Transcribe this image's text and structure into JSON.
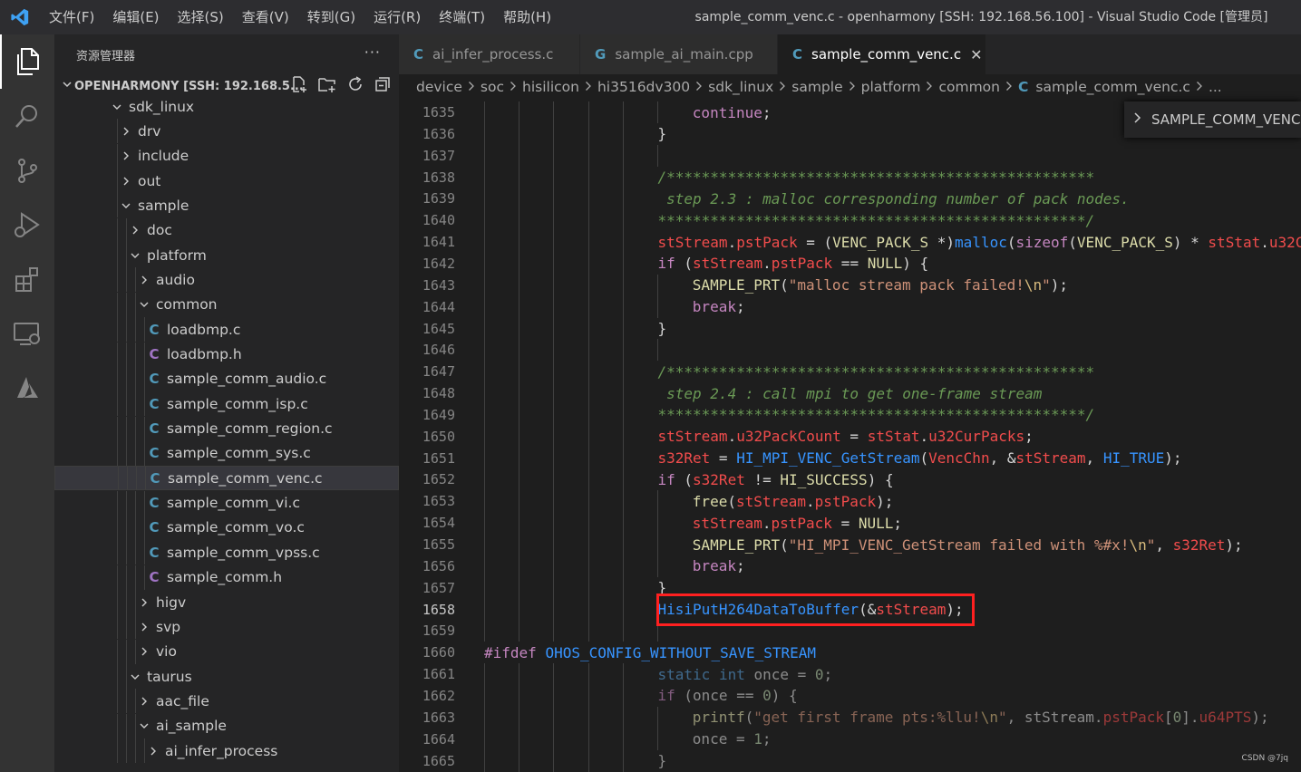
{
  "titlebar": {
    "menus": [
      "文件(F)",
      "编辑(E)",
      "选择(S)",
      "查看(V)",
      "转到(G)",
      "运行(R)",
      "终端(T)",
      "帮助(H)"
    ],
    "window_title": "sample_comm_venc.c - openharmony [SSH: 192.168.56.100] - Visual Studio Code [管理员]"
  },
  "activitybar": {
    "icons": [
      "explorer-icon",
      "search-icon",
      "source-control-icon",
      "run-debug-icon",
      "extensions-icon",
      "remote-explorer-icon",
      "azure-icon"
    ]
  },
  "sidebar": {
    "title": "资源管理器",
    "more": "···",
    "folder": "OPENHARMONY [SSH: 192.168.5...",
    "tree": [
      {
        "label": "sdk_linux",
        "type": "folder",
        "open": true,
        "depth": 0
      },
      {
        "label": "drv",
        "type": "folder",
        "open": false,
        "depth": 1
      },
      {
        "label": "include",
        "type": "folder",
        "open": false,
        "depth": 1
      },
      {
        "label": "out",
        "type": "folder",
        "open": false,
        "depth": 1
      },
      {
        "label": "sample",
        "type": "folder",
        "open": true,
        "depth": 1
      },
      {
        "label": "doc",
        "type": "folder",
        "open": false,
        "depth": 2
      },
      {
        "label": "platform",
        "type": "folder",
        "open": true,
        "depth": 2
      },
      {
        "label": "audio",
        "type": "folder",
        "open": false,
        "depth": 3
      },
      {
        "label": "common",
        "type": "folder",
        "open": true,
        "depth": 3
      },
      {
        "label": "loadbmp.c",
        "type": "c",
        "depth": 4
      },
      {
        "label": "loadbmp.h",
        "type": "h",
        "depth": 4
      },
      {
        "label": "sample_comm_audio.c",
        "type": "c",
        "depth": 4
      },
      {
        "label": "sample_comm_isp.c",
        "type": "c",
        "depth": 4
      },
      {
        "label": "sample_comm_region.c",
        "type": "c",
        "depth": 4
      },
      {
        "label": "sample_comm_sys.c",
        "type": "c",
        "depth": 4
      },
      {
        "label": "sample_comm_venc.c",
        "type": "c",
        "depth": 4,
        "selected": true
      },
      {
        "label": "sample_comm_vi.c",
        "type": "c",
        "depth": 4
      },
      {
        "label": "sample_comm_vo.c",
        "type": "c",
        "depth": 4
      },
      {
        "label": "sample_comm_vpss.c",
        "type": "c",
        "depth": 4
      },
      {
        "label": "sample_comm.h",
        "type": "h",
        "depth": 4
      },
      {
        "label": "higv",
        "type": "folder",
        "open": false,
        "depth": 3
      },
      {
        "label": "svp",
        "type": "folder",
        "open": false,
        "depth": 3
      },
      {
        "label": "vio",
        "type": "folder",
        "open": false,
        "depth": 3
      },
      {
        "label": "taurus",
        "type": "folder",
        "open": true,
        "depth": 2
      },
      {
        "label": "aac_file",
        "type": "folder",
        "open": false,
        "depth": 3
      },
      {
        "label": "ai_sample",
        "type": "folder",
        "open": true,
        "depth": 3
      },
      {
        "label": "ai_infer_process",
        "type": "folder",
        "open": false,
        "depth": 4
      }
    ]
  },
  "tabs": [
    {
      "icon": "C",
      "label": "ai_infer_process.c",
      "active": false
    },
    {
      "icon": "G",
      "label": "sample_ai_main.cpp",
      "active": false
    },
    {
      "icon": "C",
      "label": "sample_comm_venc.c",
      "active": true,
      "close": "✕"
    }
  ],
  "breadcrumb": {
    "parts": [
      "device",
      "soc",
      "hisilicon",
      "hi3516dv300",
      "sdk_linux",
      "sample",
      "platform",
      "common"
    ],
    "file_icon": "C",
    "file": "sample_comm_venc.c",
    "ellipsis": "..."
  },
  "symbol_popup": {
    "label": "SAMPLE_COMM_VENC"
  },
  "editor": {
    "current_line": 1658,
    "lines": [
      {
        "n": 1635,
        "indent": 6,
        "t": [
          [
            "ctl",
            "continue"
          ],
          [
            "plain",
            ";"
          ]
        ]
      },
      {
        "n": 1636,
        "indent": 5,
        "t": [
          [
            "plain",
            "}"
          ]
        ]
      },
      {
        "n": 1637,
        "indent": 0,
        "t": []
      },
      {
        "n": 1638,
        "indent": 5,
        "t": [
          [
            "cmt",
            "/*************************************************"
          ]
        ]
      },
      {
        "n": 1639,
        "indent": 5,
        "t": [
          [
            "cmt",
            " step 2.3 : malloc corresponding number of pack nodes."
          ]
        ]
      },
      {
        "n": 1640,
        "indent": 5,
        "t": [
          [
            "cmt",
            "*************************************************/"
          ]
        ]
      },
      {
        "n": 1641,
        "indent": 5,
        "t": [
          [
            "sv",
            "stStream"
          ],
          [
            "plain",
            "."
          ],
          [
            "sv",
            "pstPack"
          ],
          [
            "plain",
            " = ("
          ],
          [
            "yl",
            "VENC_PACK_S"
          ],
          [
            "plain",
            " *)"
          ],
          [
            "bl",
            "malloc"
          ],
          [
            "plain",
            "("
          ],
          [
            "pk",
            "sizeof"
          ],
          [
            "plain",
            "("
          ],
          [
            "yl",
            "VENC_PACK_S"
          ],
          [
            "plain",
            ") * "
          ],
          [
            "sv",
            "stStat"
          ],
          [
            "plain",
            "."
          ],
          [
            "sv",
            "u32C"
          ]
        ]
      },
      {
        "n": 1642,
        "indent": 5,
        "t": [
          [
            "pk",
            "if"
          ],
          [
            "plain",
            " ("
          ],
          [
            "sv",
            "stStream"
          ],
          [
            "plain",
            "."
          ],
          [
            "sv",
            "pstPack"
          ],
          [
            "plain",
            " == "
          ],
          [
            "yl",
            "NULL"
          ],
          [
            "plain",
            ") {"
          ]
        ]
      },
      {
        "n": 1643,
        "indent": 6,
        "t": [
          [
            "yl",
            "SAMPLE_PRT"
          ],
          [
            "plain",
            "("
          ],
          [
            "str",
            "\"malloc stream pack failed!"
          ],
          [
            "esc",
            "\\n"
          ],
          [
            "str",
            "\""
          ],
          [
            "plain",
            ");"
          ]
        ]
      },
      {
        "n": 1644,
        "indent": 6,
        "t": [
          [
            "ctl",
            "break"
          ],
          [
            "plain",
            ";"
          ]
        ]
      },
      {
        "n": 1645,
        "indent": 5,
        "t": [
          [
            "plain",
            "}"
          ]
        ]
      },
      {
        "n": 1646,
        "indent": 0,
        "t": []
      },
      {
        "n": 1647,
        "indent": 5,
        "t": [
          [
            "cmt",
            "/*************************************************"
          ]
        ]
      },
      {
        "n": 1648,
        "indent": 5,
        "t": [
          [
            "cmt",
            " step 2.4 : call mpi to get one-frame stream"
          ]
        ]
      },
      {
        "n": 1649,
        "indent": 5,
        "t": [
          [
            "cmt",
            "*************************************************/"
          ]
        ]
      },
      {
        "n": 1650,
        "indent": 5,
        "t": [
          [
            "sv",
            "stStream"
          ],
          [
            "plain",
            "."
          ],
          [
            "sv",
            "u32PackCount"
          ],
          [
            "plain",
            " = "
          ],
          [
            "sv",
            "stStat"
          ],
          [
            "plain",
            "."
          ],
          [
            "sv",
            "u32CurPacks"
          ],
          [
            "plain",
            ";"
          ]
        ]
      },
      {
        "n": 1651,
        "indent": 5,
        "t": [
          [
            "sv",
            "s32Ret"
          ],
          [
            "plain",
            " = "
          ],
          [
            "bl",
            "HI_MPI_VENC_GetStream"
          ],
          [
            "plain",
            "("
          ],
          [
            "sv",
            "VencChn"
          ],
          [
            "plain",
            ", &"
          ],
          [
            "sv",
            "stStream"
          ],
          [
            "plain",
            ", "
          ],
          [
            "bl",
            "HI_TRUE"
          ],
          [
            "plain",
            ");"
          ]
        ]
      },
      {
        "n": 1652,
        "indent": 5,
        "t": [
          [
            "pk",
            "if"
          ],
          [
            "plain",
            " ("
          ],
          [
            "sv",
            "s32Ret"
          ],
          [
            "plain",
            " != "
          ],
          [
            "yl",
            "HI_SUCCESS"
          ],
          [
            "plain",
            ") {"
          ]
        ]
      },
      {
        "n": 1653,
        "indent": 6,
        "t": [
          [
            "yl",
            "free"
          ],
          [
            "plain",
            "("
          ],
          [
            "sv",
            "stStream"
          ],
          [
            "plain",
            "."
          ],
          [
            "sv",
            "pstPack"
          ],
          [
            "plain",
            ");"
          ]
        ]
      },
      {
        "n": 1654,
        "indent": 6,
        "t": [
          [
            "sv",
            "stStream"
          ],
          [
            "plain",
            "."
          ],
          [
            "sv",
            "pstPack"
          ],
          [
            "plain",
            " = "
          ],
          [
            "yl",
            "NULL"
          ],
          [
            "plain",
            ";"
          ]
        ]
      },
      {
        "n": 1655,
        "indent": 6,
        "t": [
          [
            "yl",
            "SAMPLE_PRT"
          ],
          [
            "plain",
            "("
          ],
          [
            "str",
            "\"HI_MPI_VENC_GetStream failed with %#x!"
          ],
          [
            "esc",
            "\\n"
          ],
          [
            "str",
            "\""
          ],
          [
            "plain",
            ", "
          ],
          [
            "sv",
            "s32Ret"
          ],
          [
            "plain",
            ");"
          ]
        ]
      },
      {
        "n": 1656,
        "indent": 6,
        "t": [
          [
            "ctl",
            "break"
          ],
          [
            "plain",
            ";"
          ]
        ]
      },
      {
        "n": 1657,
        "indent": 5,
        "t": [
          [
            "plain",
            "}"
          ]
        ]
      },
      {
        "n": 1658,
        "indent": 5,
        "t": [
          [
            "bl",
            "HisiPutH264DataToBuffer"
          ],
          [
            "plain",
            "(&"
          ],
          [
            "sv",
            "stStream"
          ],
          [
            "plain",
            ");"
          ]
        ]
      },
      {
        "n": 1659,
        "indent": 0,
        "t": []
      },
      {
        "n": 1660,
        "indent": 0,
        "t": [
          [
            "pk",
            "#ifdef"
          ],
          [
            "plain",
            " "
          ],
          [
            "bl",
            "OHOS_CONFIG_WITHOUT_SAVE_STREAM"
          ]
        ]
      },
      {
        "n": 1661,
        "indent": 5,
        "dim": true,
        "t": [
          [
            "kw",
            "static"
          ],
          [
            "plain",
            " "
          ],
          [
            "kw",
            "int"
          ],
          [
            "plain",
            " once = "
          ],
          [
            "num",
            "0"
          ],
          [
            "plain",
            ";"
          ]
        ]
      },
      {
        "n": 1662,
        "indent": 5,
        "dim": true,
        "t": [
          [
            "ctl",
            "if"
          ],
          [
            "plain",
            " (once == "
          ],
          [
            "num",
            "0"
          ],
          [
            "plain",
            ") {"
          ]
        ]
      },
      {
        "n": 1663,
        "indent": 6,
        "dim": true,
        "t": [
          [
            "fn",
            "printf"
          ],
          [
            "plain",
            "("
          ],
          [
            "str",
            "\"get first frame pts:%llu!"
          ],
          [
            "esc",
            "\\n"
          ],
          [
            "str",
            "\""
          ],
          [
            "plain",
            ", stStream."
          ],
          [
            "sv",
            "pstPack"
          ],
          [
            "plain",
            "["
          ],
          [
            "num",
            "0"
          ],
          [
            "plain",
            "]."
          ],
          [
            "sv",
            "u64PTS"
          ],
          [
            "plain",
            ");"
          ]
        ]
      },
      {
        "n": 1664,
        "indent": 6,
        "dim": true,
        "t": [
          [
            "plain",
            "once = "
          ],
          [
            "num",
            "1"
          ],
          [
            "plain",
            ";"
          ]
        ]
      },
      {
        "n": 1665,
        "indent": 5,
        "dim": true,
        "t": [
          [
            "plain",
            "}"
          ]
        ]
      }
    ]
  },
  "watermark": "CSDN @7jq"
}
